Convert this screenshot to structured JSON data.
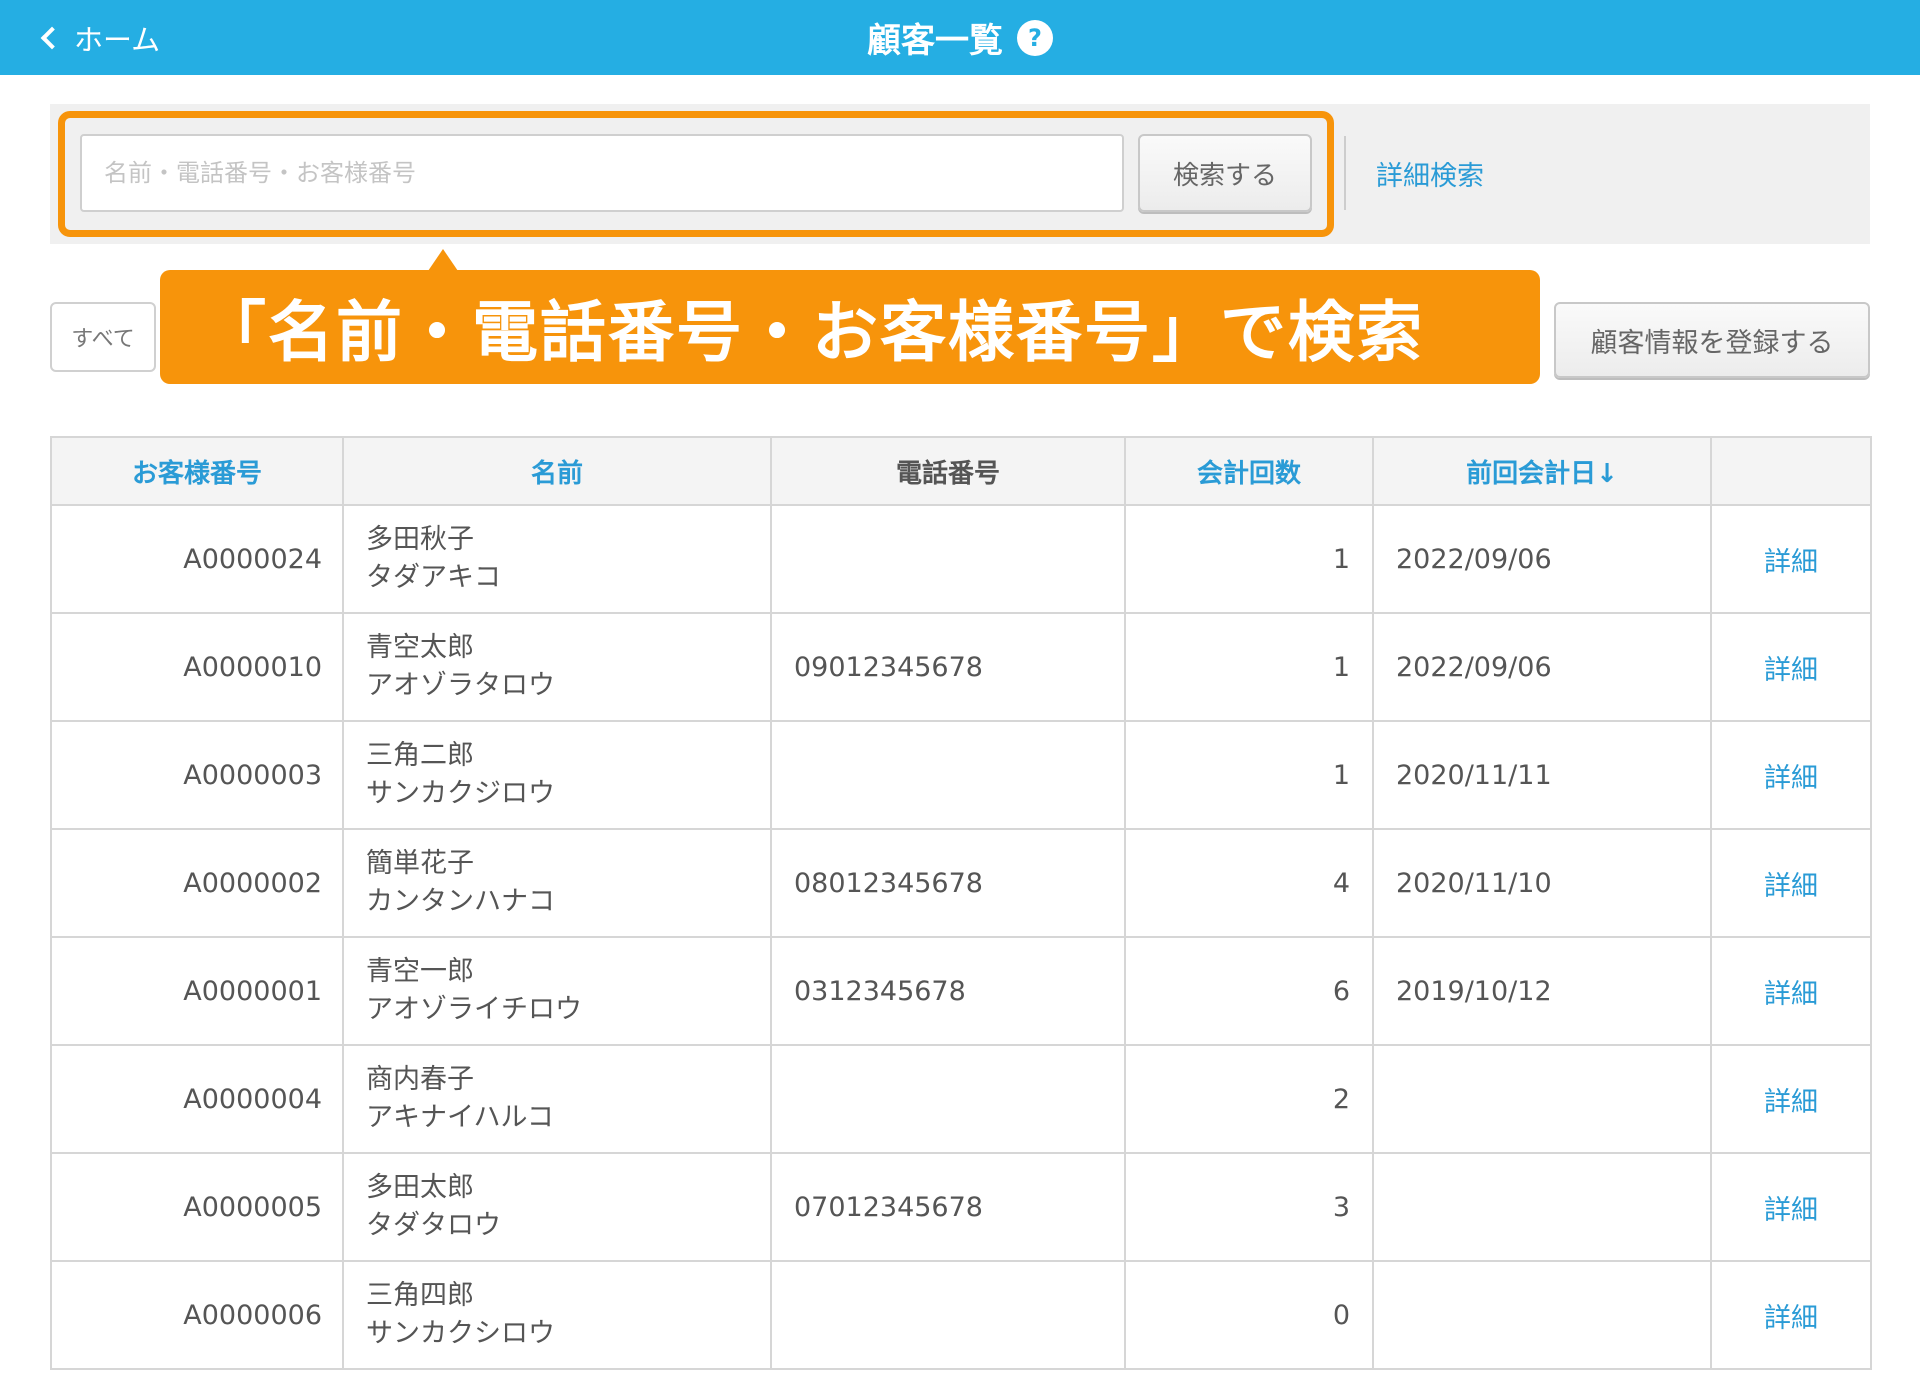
{
  "header": {
    "back_label": "ホーム",
    "title": "顧客一覧",
    "help_icon": "?"
  },
  "search": {
    "placeholder": "名前・電話番号・お客様番号",
    "value": "",
    "button_label": "検索する",
    "detail_search_label": "詳細検索"
  },
  "callout": {
    "text": "「名前・電話番号・お客様番号」で検索"
  },
  "filter": {
    "all_label": "すべて"
  },
  "register_button_label": "顧客情報を登録する",
  "table": {
    "columns": [
      "お客様番号",
      "名前",
      "電話番号",
      "会計回数",
      "前回会計日",
      ""
    ],
    "sort_indicator": "↓",
    "detail_label": "詳細",
    "rows": [
      {
        "id": "A0000024",
        "name": "多田秋子",
        "kana": "タダアキコ",
        "phone": "",
        "count": "1",
        "last_date": "2022/09/06"
      },
      {
        "id": "A0000010",
        "name": "青空太郎",
        "kana": "アオゾラタロウ",
        "phone": "09012345678",
        "count": "1",
        "last_date": "2022/09/06"
      },
      {
        "id": "A0000003",
        "name": "三角二郎",
        "kana": "サンカクジロウ",
        "phone": "",
        "count": "1",
        "last_date": "2020/11/11"
      },
      {
        "id": "A0000002",
        "name": "簡単花子",
        "kana": "カンタンハナコ",
        "phone": "08012345678",
        "count": "4",
        "last_date": "2020/11/10"
      },
      {
        "id": "A0000001",
        "name": "青空一郎",
        "kana": "アオゾライチロウ",
        "phone": "0312345678",
        "count": "6",
        "last_date": "2019/10/12"
      },
      {
        "id": "A0000004",
        "name": "商内春子",
        "kana": "アキナイハルコ",
        "phone": "",
        "count": "2",
        "last_date": ""
      },
      {
        "id": "A0000005",
        "name": "多田太郎",
        "kana": "タダタロウ",
        "phone": "07012345678",
        "count": "3",
        "last_date": ""
      },
      {
        "id": "A0000006",
        "name": "三角四郎",
        "kana": "サンカクシロウ",
        "phone": "",
        "count": "0",
        "last_date": ""
      }
    ]
  },
  "colors": {
    "header_bg": "#25aee3",
    "accent_orange": "#f7940b",
    "link_blue": "#2a9bd6"
  }
}
